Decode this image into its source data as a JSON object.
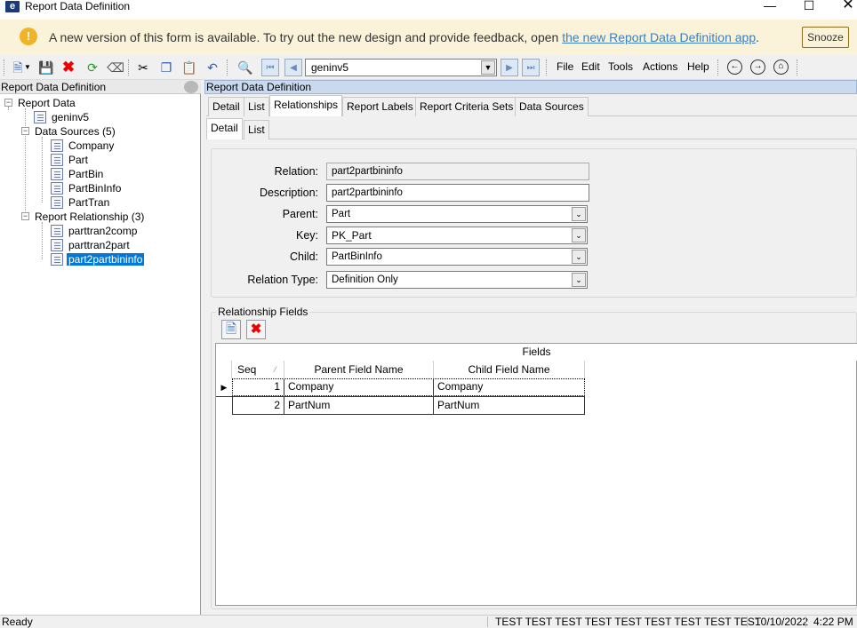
{
  "window": {
    "title": "Report Data Definition",
    "logo": "e"
  },
  "banner": {
    "message": "A new version of this form is available. To try out the new design and provide feedback, open ",
    "link": "the new Report Data Definition app",
    "link_suffix": ".",
    "snooze": "Snooze",
    "icon": "!"
  },
  "toolbar": {
    "combo_value": "geninv5",
    "menus": [
      "File",
      "Edit",
      "Tools",
      "Actions",
      "Help"
    ]
  },
  "left_panel": {
    "title": "Report Data Definition",
    "tree": {
      "root": "Report Data",
      "geninv": "geninv5",
      "data_sources": "Data Sources (5)",
      "sources": [
        "Company",
        "Part",
        "PartBin",
        "PartBinInfo",
        "PartTran"
      ],
      "relationships": "Report Relationship (3)",
      "rels": [
        "parttran2comp",
        "parttran2part",
        "part2partbininfo"
      ]
    }
  },
  "right_panel": {
    "title": "Report Data Definition",
    "main_tabs": [
      "Detail",
      "List",
      "Relationships",
      "Report Labels",
      "Report Criteria Sets",
      "Data Sources"
    ],
    "sub_tabs": [
      "Detail",
      "List"
    ],
    "form": {
      "relation_label": "Relation:",
      "relation_value": "part2partbininfo",
      "description_label": "Description:",
      "description_value": "part2partbininfo",
      "parent_label": "Parent:",
      "parent_value": "Part",
      "key_label": "Key:",
      "key_value": "PK_Part",
      "child_label": "Child:",
      "child_value": "PartBinInfo",
      "reltype_label": "Relation Type:",
      "reltype_value": "Definition Only"
    },
    "rel_fields": {
      "label": "Relationship Fields",
      "band": "Fields",
      "headers": [
        "Seq",
        "Parent Field Name",
        "Child Field Name"
      ],
      "rows": [
        {
          "seq": "1",
          "parent": "Company",
          "child": "Company"
        },
        {
          "seq": "2",
          "parent": "PartNum",
          "child": "PartNum"
        }
      ]
    }
  },
  "status": {
    "left": "Ready",
    "middle": "TEST TEST TEST TEST TEST TEST TEST TEST TEST",
    "date": "10/10/2022",
    "time": "4:22 PM"
  },
  "colors": {
    "banner_bg": "#fbf3d9",
    "selection": "#0078d7",
    "link": "#3b7fc4",
    "header_blue": "#c9d9ee"
  }
}
